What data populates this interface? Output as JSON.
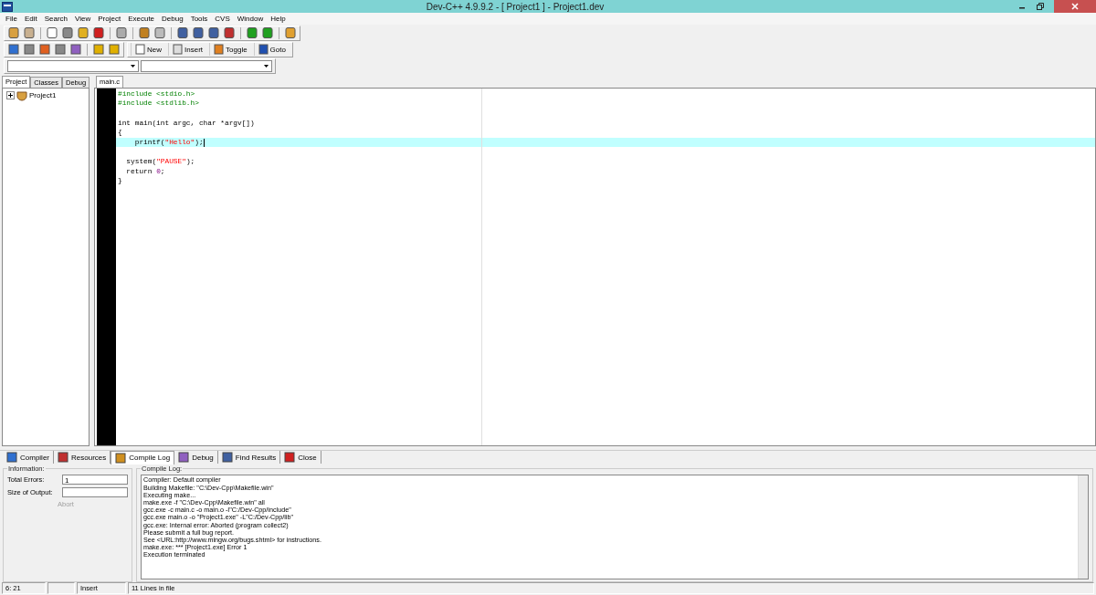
{
  "window": {
    "title": "Dev-C++ 4.9.9.2  - [ Project1 ] - Project1.dev"
  },
  "menu": [
    "File",
    "Edit",
    "Search",
    "View",
    "Project",
    "Execute",
    "Debug",
    "Tools",
    "CVS",
    "Window",
    "Help"
  ],
  "bookmark_buttons": [
    "New",
    "Insert",
    "Toggle",
    "Goto"
  ],
  "left_tabs": [
    {
      "label": "Project",
      "selected": true
    },
    {
      "label": "Classes",
      "selected": false
    },
    {
      "label": "Debug",
      "selected": false
    }
  ],
  "project_tree": [
    {
      "label": "Project1",
      "expanded": false
    }
  ],
  "editor_tabs": [
    {
      "label": "main.c",
      "selected": true
    }
  ],
  "code_lines": [
    {
      "current": false,
      "tokens": [
        {
          "kind": "pre",
          "text": "#include <stdio.h>"
        }
      ]
    },
    {
      "current": false,
      "tokens": [
        {
          "kind": "pre",
          "text": "#include <stdlib.h>"
        }
      ]
    },
    {
      "current": false
    },
    {
      "current": false,
      "tokens": [
        {
          "kind": "plain",
          "text": "int main(int argc, char *argv[])"
        }
      ]
    },
    {
      "current": false,
      "tokens": [
        {
          "kind": "plain",
          "text": "{"
        }
      ]
    },
    {
      "current": true,
      "tokens": [
        {
          "kind": "plain",
          "text": "    printf("
        },
        {
          "kind": "string",
          "text": "\"Hello\""
        },
        {
          "kind": "plain",
          "text": ");"
        }
      ]
    },
    {
      "current": false
    },
    {
      "current": false,
      "tokens": [
        {
          "kind": "plain",
          "text": "  system("
        },
        {
          "kind": "string",
          "text": "\"PAUSE\""
        },
        {
          "kind": "plain",
          "text": ");"
        }
      ]
    },
    {
      "current": false,
      "tokens": [
        {
          "kind": "plain",
          "text": "  return "
        },
        {
          "kind": "number",
          "text": "0"
        },
        {
          "kind": "plain",
          "text": ";"
        }
      ]
    },
    {
      "current": false,
      "tokens": [
        {
          "kind": "plain",
          "text": "}"
        }
      ]
    }
  ],
  "bottom_tabs": [
    {
      "label": "Compiler",
      "selected": false
    },
    {
      "label": "Resources",
      "selected": false
    },
    {
      "label": "Compile Log",
      "selected": true
    },
    {
      "label": "Debug",
      "selected": false
    },
    {
      "label": "Find Results",
      "selected": false
    },
    {
      "label": "Close",
      "selected": false
    }
  ],
  "information": {
    "title": "Information:",
    "total_errors_label": "Total Errors:",
    "total_errors": "1",
    "size_label": "Size of Output:",
    "abort": {
      "label": "Abort",
      "disabled": true
    }
  },
  "compile_log": {
    "title": "Compile Log:",
    "lines": [
      "Compiler: Default compiler",
      "Building Makefile: \"C:\\Dev-Cpp\\Makefile.win\"",
      "Executing  make...",
      "make.exe -f \"C:\\Dev-Cpp\\Makefile.win\" all",
      "gcc.exe -c main.c -o main.o -I\"C:/Dev-Cpp/include\"",
      "gcc.exe main.o  -o \"Project1.exe\" -L\"C:/Dev-Cpp/lib\"",
      "gcc.exe: Internal error: Aborted (program collect2)",
      "Please submit a full bug report.",
      "See <URL:http://www.mingw.org/bugs.shtml> for instructions.",
      "make.exe: *** [Project1.exe] Error 1",
      "Execution terminated"
    ]
  },
  "status_bar": {
    "position": "6: 21",
    "mode": "Insert",
    "info": "11 Lines in file"
  }
}
